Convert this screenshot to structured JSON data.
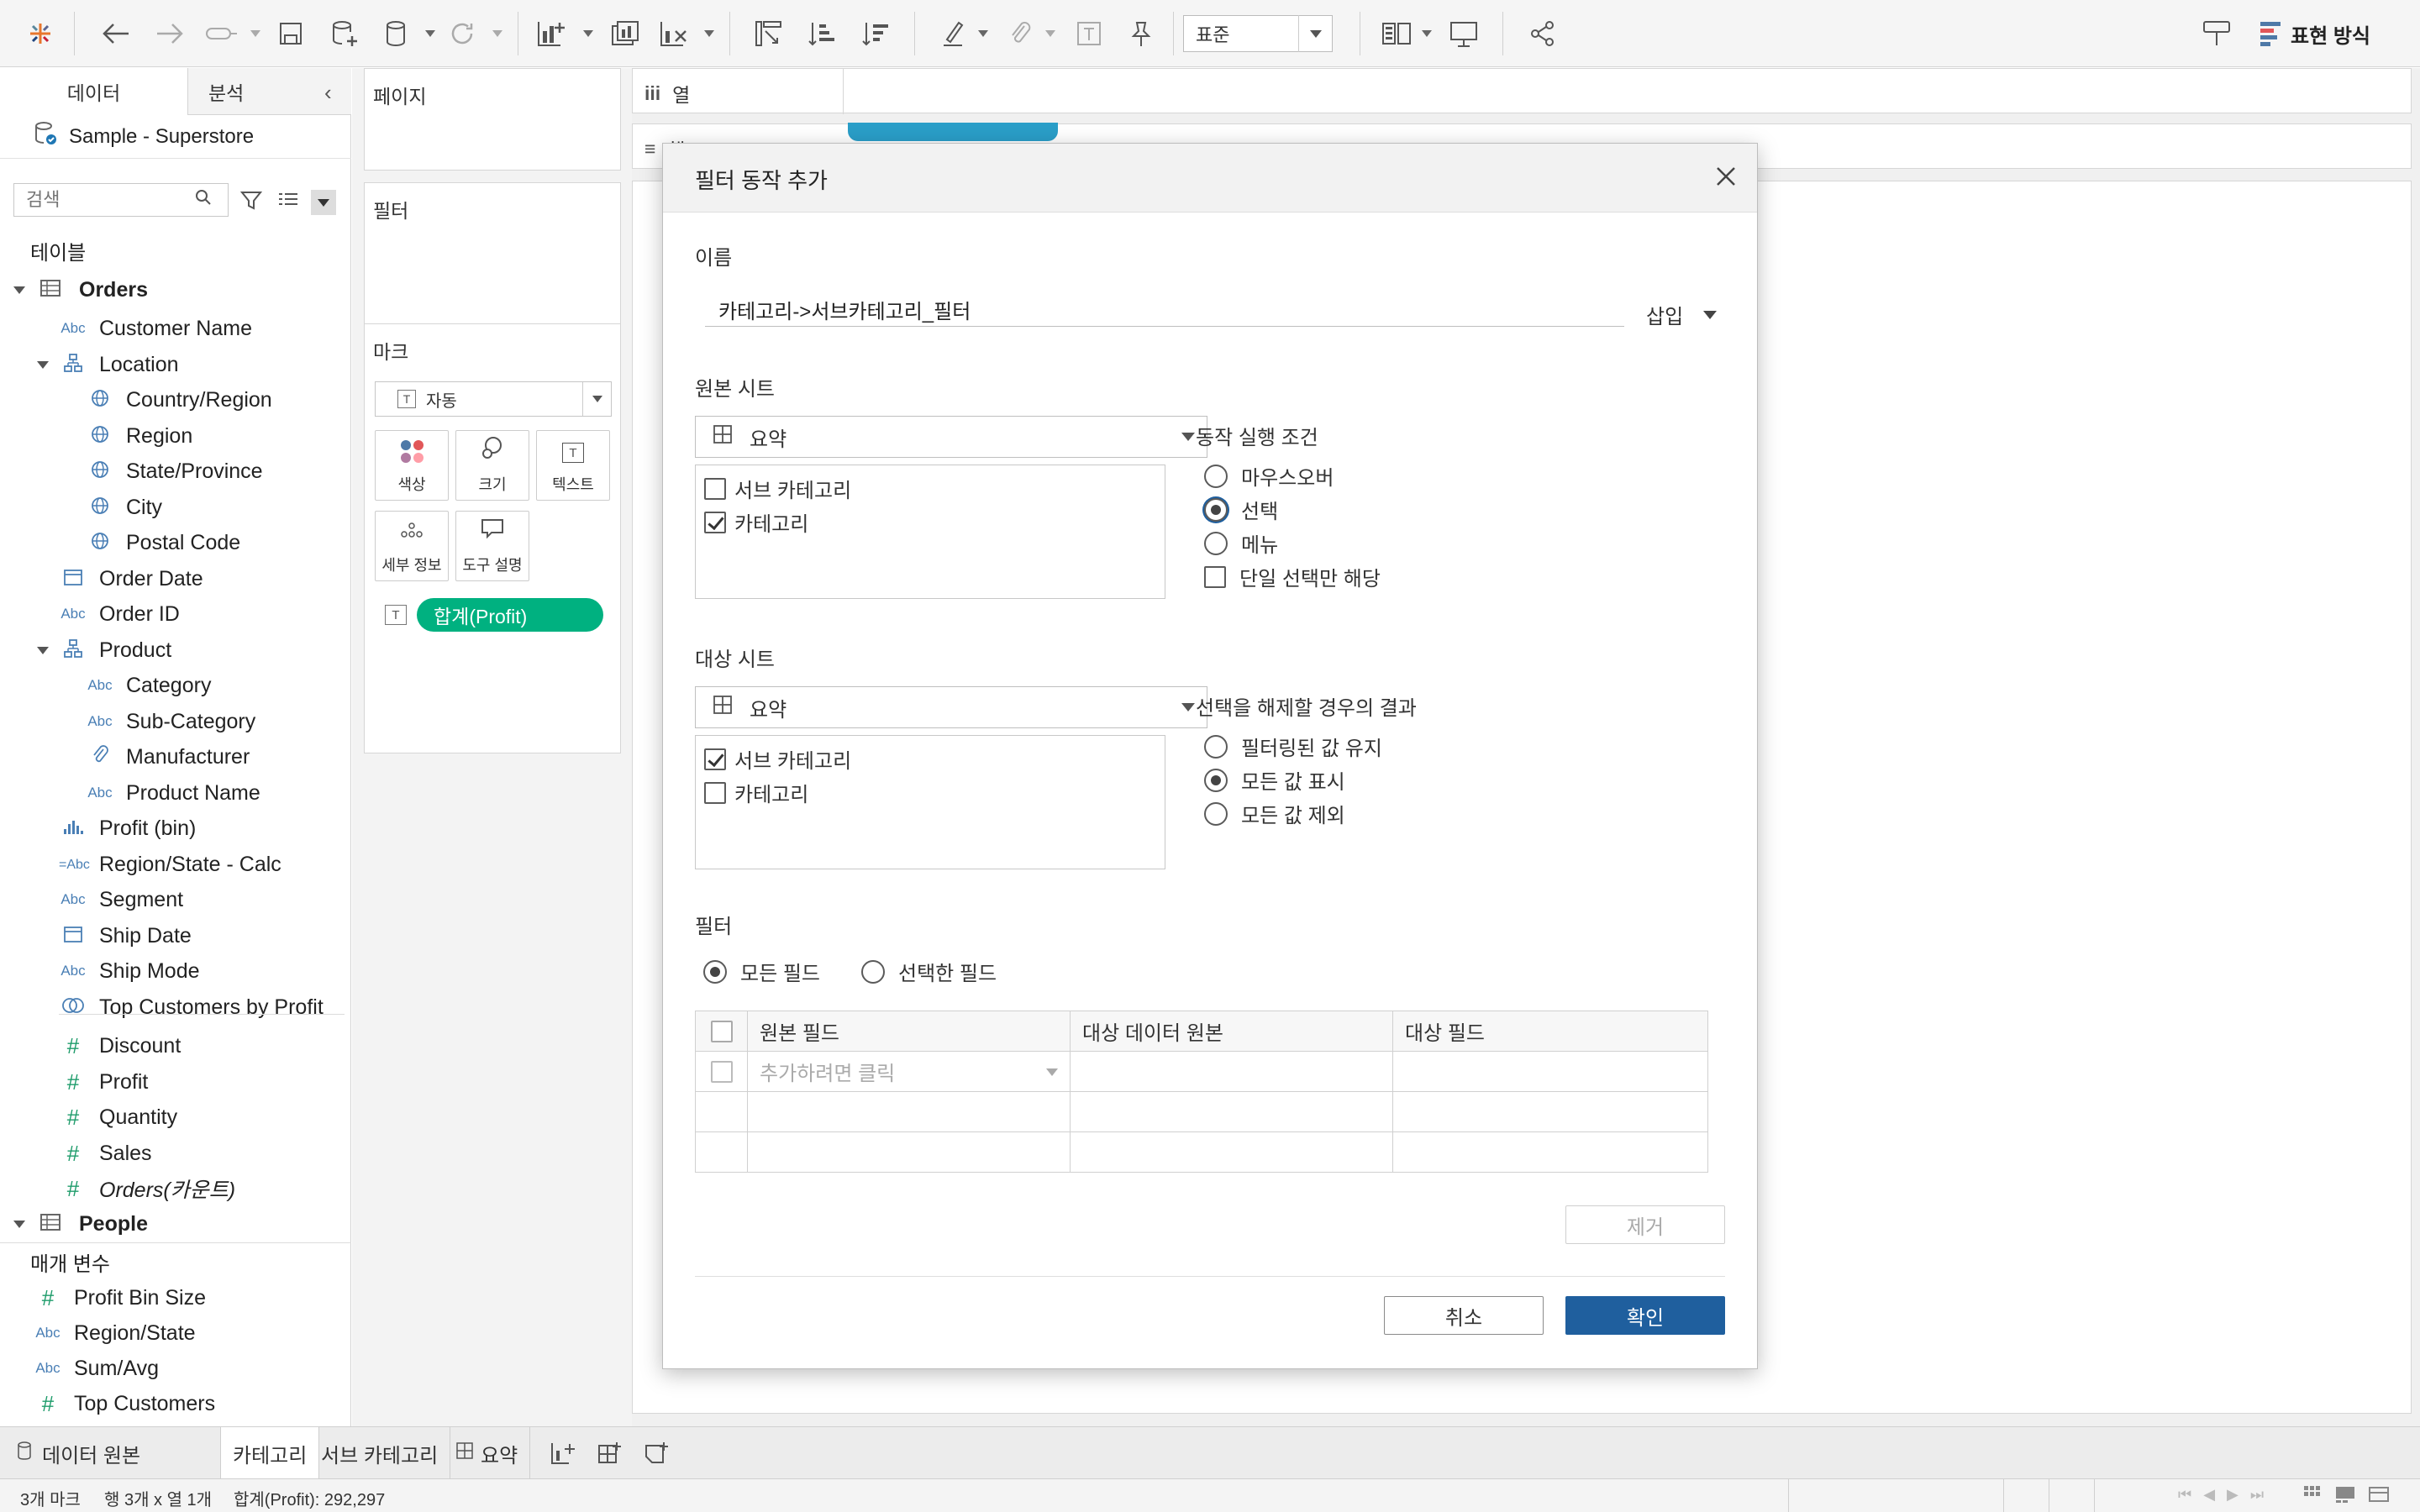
{
  "toolbar": {
    "format_select": "표준",
    "show_me_label": "표현 방식"
  },
  "left_pane": {
    "tab_data": "데이터",
    "tab_analysis": "분석",
    "datasource": "Sample - Superstore",
    "search_placeholder": "검색",
    "tables_header": "테이블",
    "orders_table": "Orders",
    "fields": [
      {
        "icon": "Abc",
        "label": "Customer Name"
      },
      {
        "icon": "hierarchy",
        "label": "Location"
      },
      {
        "icon": "globe",
        "label": "Country/Region"
      },
      {
        "icon": "globe",
        "label": "Region"
      },
      {
        "icon": "globe",
        "label": "State/Province"
      },
      {
        "icon": "globe",
        "label": "City"
      },
      {
        "icon": "globe",
        "label": "Postal Code"
      },
      {
        "icon": "calendar",
        "label": "Order Date"
      },
      {
        "icon": "Abc",
        "label": "Order ID"
      },
      {
        "icon": "hierarchy",
        "label": "Product"
      },
      {
        "icon": "Abc",
        "label": "Category"
      },
      {
        "icon": "Abc",
        "label": "Sub-Category"
      },
      {
        "icon": "paperclip",
        "label": "Manufacturer"
      },
      {
        "icon": "Abc",
        "label": "Product Name"
      },
      {
        "icon": "bin",
        "label": "Profit (bin)"
      },
      {
        "icon": "=Abc",
        "label": "Region/State - Calc"
      },
      {
        "icon": "Abc",
        "label": "Segment"
      },
      {
        "icon": "calendar",
        "label": "Ship Date"
      },
      {
        "icon": "Abc",
        "label": "Ship Mode"
      },
      {
        "icon": "set",
        "label": "Top Customers by Profit"
      },
      {
        "icon": "#",
        "label": "Discount"
      },
      {
        "icon": "#",
        "label": "Profit"
      },
      {
        "icon": "#",
        "label": "Quantity"
      },
      {
        "icon": "#",
        "label": "Sales"
      },
      {
        "icon": "#",
        "label": "Orders(카운트)"
      }
    ],
    "people_table": "People",
    "params_header": "매개 변수",
    "params": [
      {
        "icon": "#",
        "label": "Profit Bin Size"
      },
      {
        "icon": "Abc",
        "label": "Region/State"
      },
      {
        "icon": "Abc",
        "label": "Sum/Avg"
      },
      {
        "icon": "#",
        "label": "Top Customers"
      }
    ]
  },
  "shelves": {
    "pages": "페이지",
    "filters": "필터",
    "marks": "마크",
    "mark_type": "자동",
    "mark_color": "색상",
    "mark_size": "크기",
    "mark_text": "텍스트",
    "mark_detail": "세부 정보",
    "mark_tooltip": "도구 설명",
    "mark_pill": "합계(Profit)",
    "columns": "열",
    "rows": "행"
  },
  "dialog": {
    "title": "필터 동작 추가",
    "name_label": "이름",
    "name_value": "카테고리->서브카테고리_필터",
    "insert_label": "삽입",
    "source_label": "원본 시트",
    "source_dropdown": "요약",
    "source_sheets": [
      {
        "label": "서브 카테고리",
        "checked": false
      },
      {
        "label": "카테고리",
        "checked": true
      }
    ],
    "run_on_label": "동작 실행 조건",
    "run_on_options": [
      {
        "label": "마우스오버",
        "selected": false
      },
      {
        "label": "선택",
        "selected": true
      },
      {
        "label": "메뉴",
        "selected": false
      }
    ],
    "single_select_only": "단일 선택만 해당",
    "target_label": "대상 시트",
    "target_dropdown": "요약",
    "target_sheets": [
      {
        "label": "서브 카테고리",
        "checked": true
      },
      {
        "label": "카테고리",
        "checked": false
      }
    ],
    "clearing_label": "선택을 해제할 경우의 결과",
    "clearing_options": [
      {
        "label": "필터링된 값 유지",
        "selected": false
      },
      {
        "label": "모든 값 표시",
        "selected": true
      },
      {
        "label": "모든 값 제외",
        "selected": false
      }
    ],
    "filters_label": "필터",
    "all_fields": "모든 필드",
    "selected_fields": "선택한 필드",
    "table_headers": [
      "원본 필드",
      "대상 데이터 원본",
      "대상 필드"
    ],
    "add_placeholder": "추가하려면 클릭",
    "remove_button": "제거",
    "cancel_button": "취소",
    "ok_button": "확인"
  },
  "sheet_tabs": {
    "data_source": "데이터 원본",
    "tabs": [
      "카테고리",
      "서브 카테고리",
      "요약"
    ]
  },
  "status": {
    "marks": "3개 마크",
    "rows_cols": "행 3개 x 열 1개",
    "sum": "합계(Profit): 292,297"
  },
  "colors": {
    "accent_blue": "#1f5f9e",
    "pill_green": "#00b180",
    "measure_green": "#1f9c6b",
    "dim_blue": "#4a7fb5"
  }
}
